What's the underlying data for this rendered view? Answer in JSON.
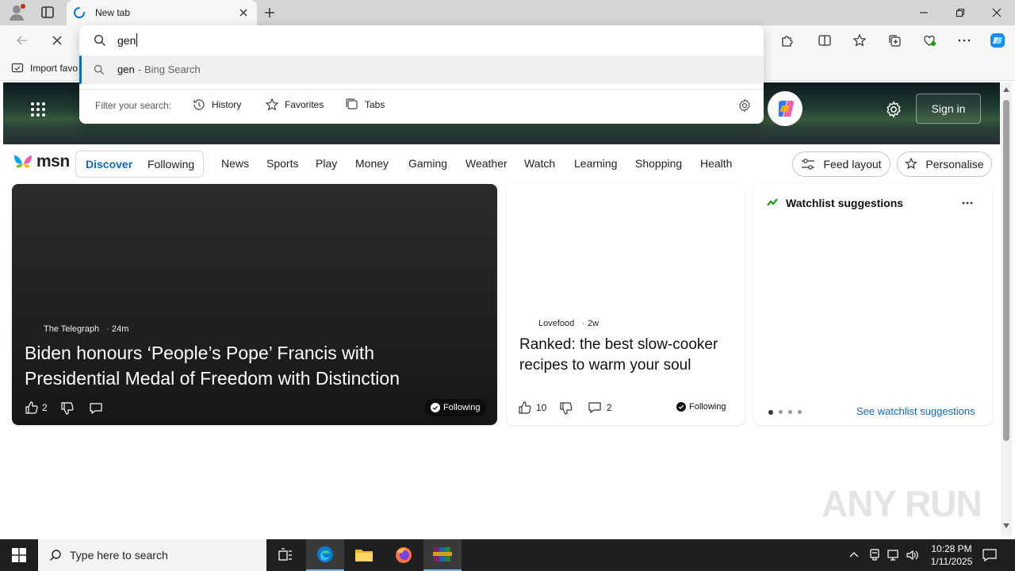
{
  "browser": {
    "tab_title": "New tab",
    "fav_label": "Import favo",
    "address_value": "gen"
  },
  "omnibox": {
    "suggestion_query": "gen",
    "suggestion_suffix": " - Bing Search",
    "filter_label": "Filter your search:",
    "filters": [
      "History",
      "Favorites",
      "Tabs"
    ]
  },
  "hero": {
    "sign_in": "Sign in"
  },
  "msn": {
    "brand": "msn",
    "pills": [
      "Discover",
      "Following"
    ],
    "nav": [
      "News",
      "Sports",
      "Play",
      "Money",
      "Gaming",
      "Weather",
      "Watch",
      "Learning",
      "Shopping",
      "Health"
    ],
    "feed_layout": "Feed layout",
    "personalise": "Personalise"
  },
  "cards": {
    "main": {
      "source": "The Telegraph",
      "age": "24m",
      "headline": "Biden honours ‘People’s Pope’ Francis with Presidential Medal of Freedom with Distinction",
      "likes": "2",
      "following": "Following"
    },
    "second": {
      "source": "Lovefood",
      "age": "2w",
      "headline": "Ranked: the best slow-cooker recipes to warm your soul",
      "likes": "10",
      "comments": "2",
      "following": "Following"
    },
    "watchlist": {
      "title": "Watchlist suggestions",
      "see_link": "See watchlist suggestions"
    }
  },
  "watermark": "ANY RUN",
  "taskbar": {
    "search_placeholder": "Type here to search",
    "time": "10:28 PM",
    "date": "1/11/2025"
  },
  "colors": {
    "accent": "#0f6cbd",
    "edge_blue": "#0078d4",
    "taskbar": "#1f1f1f"
  }
}
